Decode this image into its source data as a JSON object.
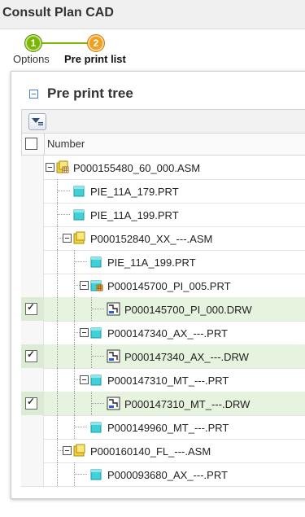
{
  "app": {
    "title": "Consult Plan CAD"
  },
  "wizard": {
    "steps": [
      {
        "number": "1",
        "label": "Options",
        "state": "done",
        "color": "#7ab800"
      },
      {
        "number": "2",
        "label": "Pre print list",
        "state": "current",
        "color": "#f0a020"
      }
    ]
  },
  "panel": {
    "title": "Pre print tree"
  },
  "grid": {
    "column_header": "Number",
    "rows": [
      {
        "label": "P000155480_60_000.ASM",
        "type": "asm-root",
        "checked": false
      },
      {
        "label": "PIE_11A_179.PRT",
        "type": "prt",
        "checked": false
      },
      {
        "label": "PIE_11A_199.PRT",
        "type": "prt",
        "checked": false
      },
      {
        "label": "P000152840_XX_---.ASM",
        "type": "asm",
        "checked": false
      },
      {
        "label": "PIE_11A_199.PRT",
        "type": "prt",
        "checked": false
      },
      {
        "label": "P000145700_PI_005.PRT",
        "type": "prt-family",
        "checked": false
      },
      {
        "label": "P000145700_PI_000.DRW",
        "type": "drw",
        "checked": true
      },
      {
        "label": "P000147340_AX_---.PRT",
        "type": "prt",
        "checked": false
      },
      {
        "label": "P000147340_AX_---.DRW",
        "type": "drw",
        "checked": true
      },
      {
        "label": "P000147310_MT_---.PRT",
        "type": "prt",
        "checked": false
      },
      {
        "label": "P000147310_MT_---.DRW",
        "type": "drw",
        "checked": true
      },
      {
        "label": "P000149960_MT_---.PRT",
        "type": "prt",
        "checked": false
      },
      {
        "label": "P000160140_FL_---.ASM",
        "type": "asm",
        "checked": false
      },
      {
        "label": "P000093680_AX_---.PRT",
        "type": "prt",
        "checked": false
      }
    ]
  },
  "colors": {
    "selected_row": "#e6f3df",
    "part_icon": "#3fd0d8",
    "assembly_icon": "#f2d23a"
  }
}
